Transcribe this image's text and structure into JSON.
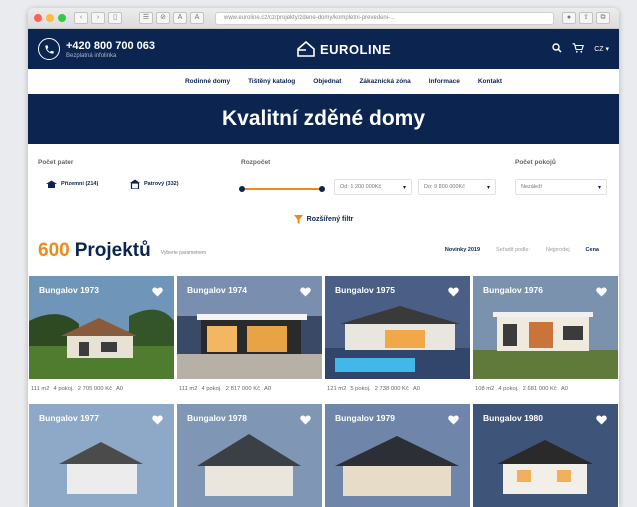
{
  "browser": {
    "url": "www.euroline.cz/cz/projekty/zdene-domy/kompletni-prevedeni-..."
  },
  "header": {
    "phone": "+420 800 700 063",
    "phone_sub": "Bezplatná infolinka",
    "logo": "EUROLINE",
    "lang": "CZ"
  },
  "nav": [
    "Rodinné domy",
    "Tištěný katalog",
    "Objednat",
    "Zákaznická zóna",
    "Informace",
    "Kontakt"
  ],
  "hero": {
    "title": "Kvalitní zděné domy"
  },
  "filters": {
    "floors_label": "Počet pater",
    "floor1": "Přízemní (214)",
    "floor2": "Patrový (332)",
    "budget_label": "Rozpočet",
    "budget_from": "Od: 1 200 000Kč",
    "budget_to": "Do: 9 800 000Kč",
    "rooms_label": "Počet pokojů",
    "rooms_value": "Nezáleží",
    "extended": "Rozšířený filtr"
  },
  "results": {
    "count": "600",
    "label": "Projektů",
    "params": "Vyberte parametrem",
    "sort_new": "Novinky 2019",
    "sort_by": "Seřadit podle:",
    "sort_popular": "Nejprodej",
    "sort_price": "Cena"
  },
  "cards": [
    {
      "title": "Bungalov 1973",
      "area": "111 m2",
      "rooms": "4 pokoj.",
      "price": "2 705 000 Kč",
      "energy": "A0"
    },
    {
      "title": "Bungalov 1974",
      "area": "111 m2",
      "rooms": "4 pokoj.",
      "price": "2 817 000 Kč",
      "energy": "A0"
    },
    {
      "title": "Bungalov 1975",
      "area": "121 m2",
      "rooms": "5 pokoj.",
      "price": "2 738 000 Kč",
      "energy": "A0"
    },
    {
      "title": "Bungalov 1976",
      "area": "108 m2",
      "rooms": "4 pokoj.",
      "price": "2 681 000 Kč",
      "energy": "A0"
    },
    {
      "title": "Bungalov 1977"
    },
    {
      "title": "Bungalov 1978"
    },
    {
      "title": "Bungalov 1979"
    },
    {
      "title": "Bungalov 1980"
    }
  ],
  "colors": {
    "navy": "#0c2550",
    "orange": "#f0891c"
  },
  "icons": {
    "phone": "phone-icon",
    "search": "search-icon",
    "cart": "cart-icon",
    "heart": "heart-icon",
    "filter": "filter-funnel-icon"
  }
}
